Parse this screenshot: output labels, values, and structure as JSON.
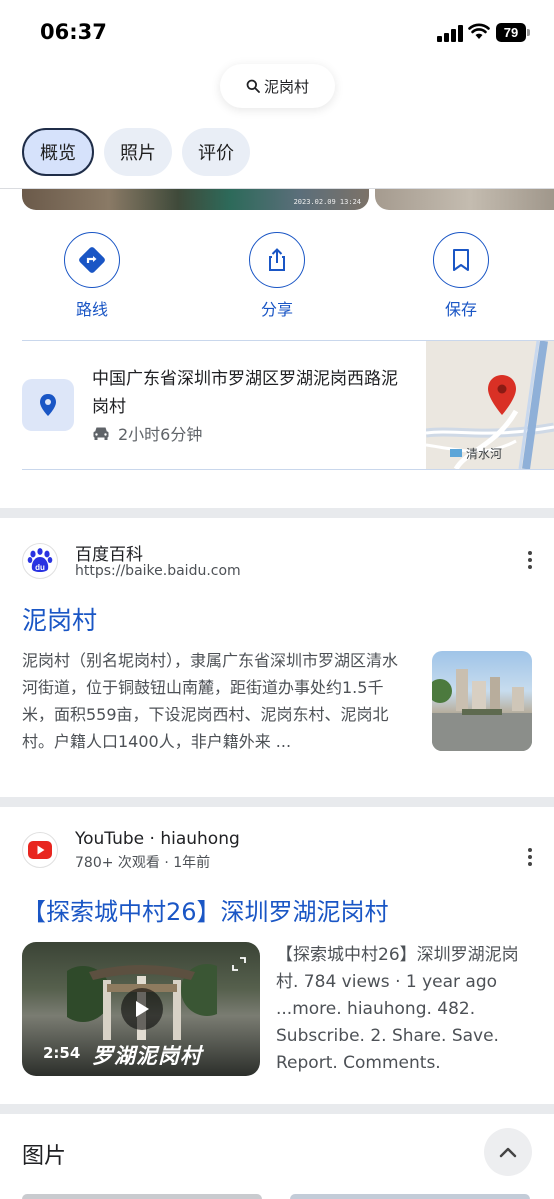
{
  "status_bar": {
    "time": "06:37",
    "battery": "79"
  },
  "search": {
    "query": "泥岗村"
  },
  "tabs": [
    {
      "label": "概览"
    },
    {
      "label": "照片"
    },
    {
      "label": "评价"
    }
  ],
  "photo_strip": {
    "stamp": "2023.02.09 13:24"
  },
  "actions": {
    "directions": "路线",
    "share": "分享",
    "save": "保存"
  },
  "place": {
    "address": "中国广东省深圳市罗湖区罗湖泥岗西路泥岗村",
    "drive_time": "2小时6分钟",
    "map_label": "清水河"
  },
  "results": [
    {
      "site_name": "百度百科",
      "site_url": "https://baike.baidu.com",
      "title": "泥岗村",
      "snippet": "泥岗村（别名坭岗村），隶属广东省深圳市罗湖区清水河街道，位于铜鼓钮山南麓，距街道办事处约1.5千米，面积559亩，下设泥岗西村、泥岗东村、泥岗北村。户籍人口1400人，非户籍外来 ..."
    },
    {
      "site_name": "YouTube · hiauhong",
      "meta": "780+ 次观看 · 1年前",
      "title": "【探索城中村26】深圳罗湖泥岗村",
      "duration": "2:54",
      "thumb_caption": "罗湖泥岗村",
      "snippet": "【探索城中村26】深圳罗湖泥岗村. 784 views · 1 year ago ...more. hiauhong. 482. Subscribe. 2. Share. Save. Report. Comments."
    }
  ],
  "images_section": {
    "title": "图片"
  },
  "colors": {
    "link_blue": "#1a56c5",
    "chip_bg": "#e9eef6",
    "chip_active_bg": "#d6e2fb",
    "map_pin_red": "#d93025"
  }
}
